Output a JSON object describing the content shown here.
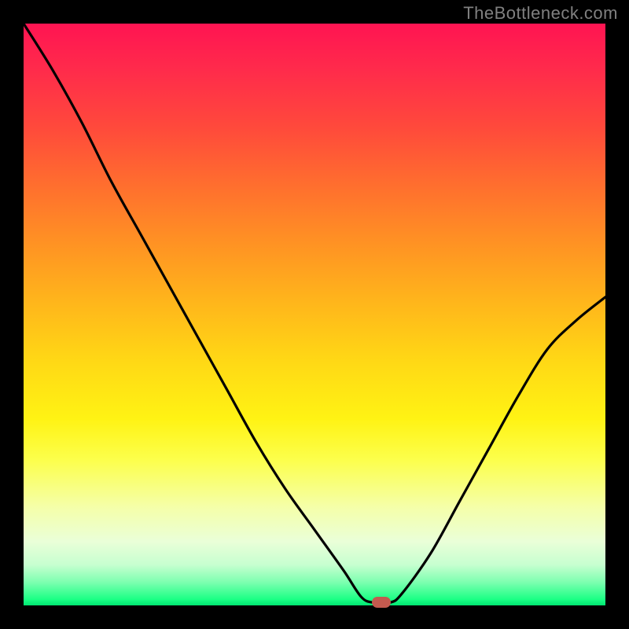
{
  "watermark": "TheBottleneck.com",
  "colors": {
    "frame_bg": "#000000",
    "curve_stroke": "#000000",
    "marker_fill": "#c35a4f",
    "gradient_top": "#ff1452",
    "gradient_bottom": "#00e572"
  },
  "chart_data": {
    "type": "line",
    "title": "",
    "xlabel": "",
    "ylabel": "",
    "xlim": [
      0,
      100
    ],
    "ylim": [
      0,
      100
    ],
    "grid": false,
    "legend": false,
    "annotations": [
      "TheBottleneck.com"
    ],
    "x": [
      0,
      5,
      10,
      15,
      20,
      25,
      30,
      35,
      40,
      45,
      50,
      55,
      58,
      60,
      63,
      65,
      70,
      75,
      80,
      85,
      90,
      95,
      100
    ],
    "y": [
      100,
      92,
      83,
      73,
      64,
      55,
      46,
      37,
      28,
      20,
      13,
      6,
      1.5,
      0.5,
      0.5,
      2,
      9,
      18,
      27,
      36,
      44,
      49,
      53
    ],
    "marker": {
      "x": 61.5,
      "y": 0.6
    },
    "description": "V-shaped bottleneck curve on a vertical green-to-red gradient; the curve falls from top-left to a minimum near x≈60 (green band) and rises again toward the right."
  }
}
